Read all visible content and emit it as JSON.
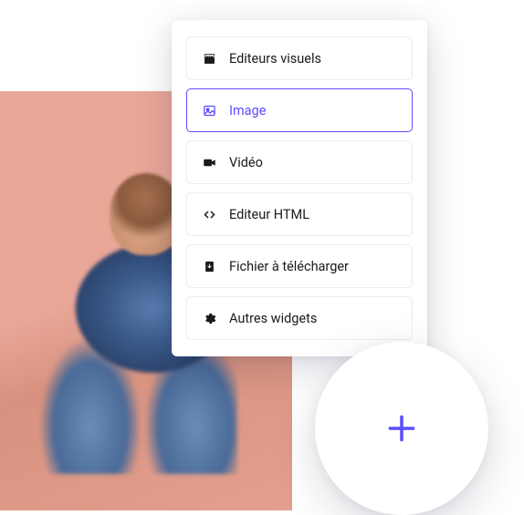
{
  "menu": {
    "options": [
      {
        "key": "editeurs-visuels",
        "label": "Editeurs visuels",
        "icon": "clapperboard-icon",
        "selected": false
      },
      {
        "key": "image",
        "label": "Image",
        "icon": "image-icon",
        "selected": true
      },
      {
        "key": "video",
        "label": "Vidéo",
        "icon": "video-icon",
        "selected": false
      },
      {
        "key": "editeur-html",
        "label": "Editeur HTML",
        "icon": "code-icon",
        "selected": false
      },
      {
        "key": "fichier-telecharger",
        "label": "Fichier à télécharger",
        "icon": "file-download-icon",
        "selected": false
      },
      {
        "key": "autres-widgets",
        "label": "Autres widgets",
        "icon": "gear-icon",
        "selected": false
      }
    ]
  },
  "colors": {
    "accent": "#5b4cff",
    "border": "#ececf0",
    "text": "#1a1a1f"
  }
}
